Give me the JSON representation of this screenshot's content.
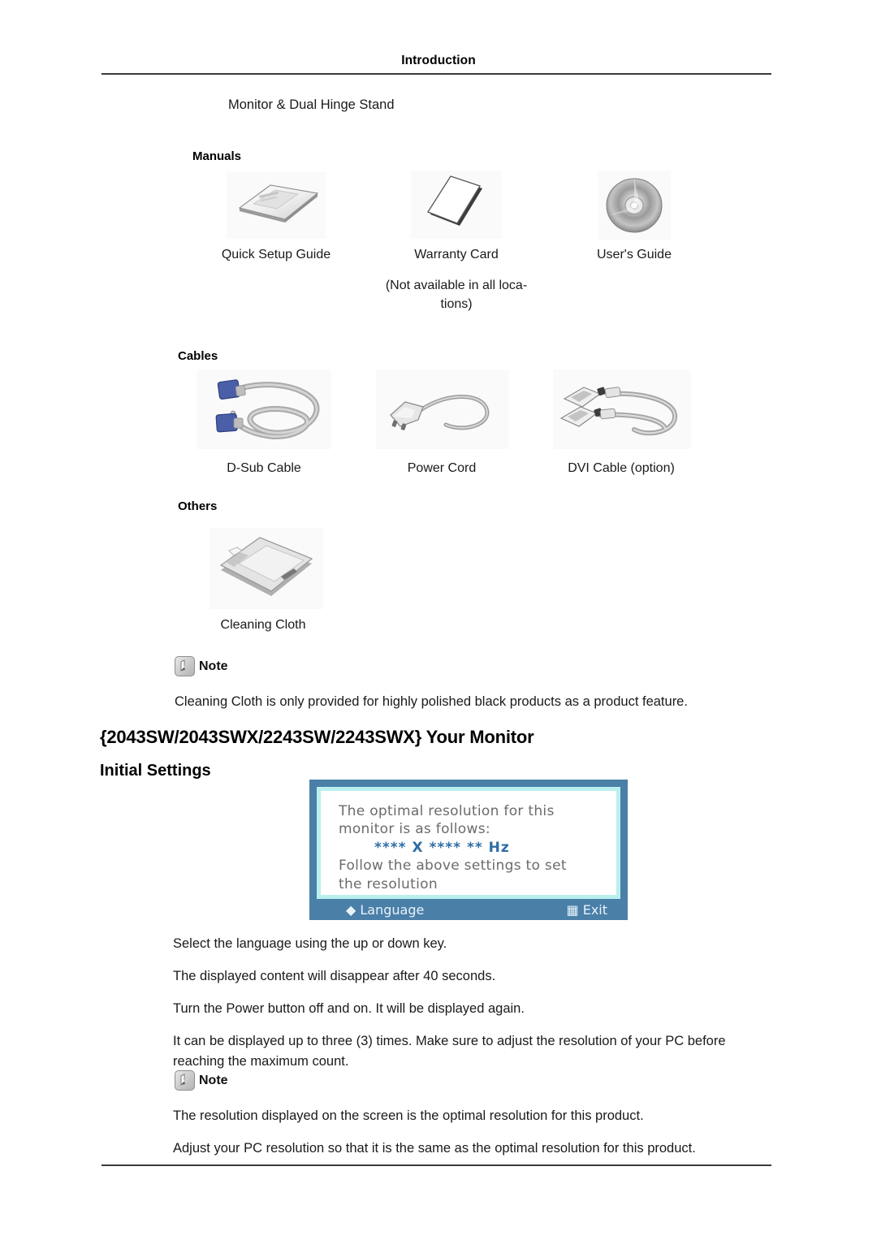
{
  "header": {
    "title": "Introduction"
  },
  "intro": {
    "subtitle": "Monitor & Dual Hinge Stand"
  },
  "sections": {
    "manuals": {
      "heading": "Manuals",
      "items": [
        {
          "icon": "booklet-icon",
          "caption": "Quick Setup Guide",
          "note": ""
        },
        {
          "icon": "card-icon",
          "caption": "Warranty Card",
          "note": "(Not available in all loca-\ntions)"
        },
        {
          "icon": "cd-disc-icon",
          "caption": "User's Guide",
          "note": ""
        }
      ]
    },
    "cables": {
      "heading": "Cables",
      "items": [
        {
          "icon": "dsub-cable-icon",
          "caption": "D-Sub Cable"
        },
        {
          "icon": "power-cord-icon",
          "caption": "Power Cord"
        },
        {
          "icon": "dvi-cable-icon",
          "caption": "DVI Cable (option)"
        }
      ]
    },
    "others": {
      "heading": "Others",
      "items": [
        {
          "icon": "cleaning-cloth-icon",
          "caption": "Cleaning Cloth"
        }
      ]
    }
  },
  "note_one": {
    "label": "Note",
    "text": "Cleaning Cloth is only provided for highly polished black products as a product feature."
  },
  "monitor_section": {
    "title": "{2043SW/2043SWX/2243SW/2243SWX} Your Monitor",
    "subtitle": "Initial Settings"
  },
  "osd": {
    "line1": "The optimal resolution for this",
    "line2": "monitor is as follows:",
    "resolution": "**** X **** ** Hz",
    "line3": "Follow the above settings to set",
    "line4": "the resolution",
    "left_key": "Language",
    "left_key_icon": "diamond-updown-icon",
    "right_key": "Exit",
    "right_key_icon": "menu-bars-icon",
    "frame_color": "#4a7fa8",
    "inner_border_color": "#b9f0ee",
    "resolution_color": "#2e6da4"
  },
  "instructions": [
    "Select the language using the up or down key.",
    "The displayed content will disappear after 40 seconds.",
    "Turn the Power button off and on. It will be displayed again.",
    "It can be displayed up to three (3) times. Make sure to adjust the resolution of your PC before reaching the maximum count."
  ],
  "note_two": {
    "label": "Note",
    "text_one": "The resolution displayed on the screen is the optimal resolution for this product.",
    "text_two": "Adjust your PC resolution so that it is the same as the optimal resolution for this product."
  }
}
